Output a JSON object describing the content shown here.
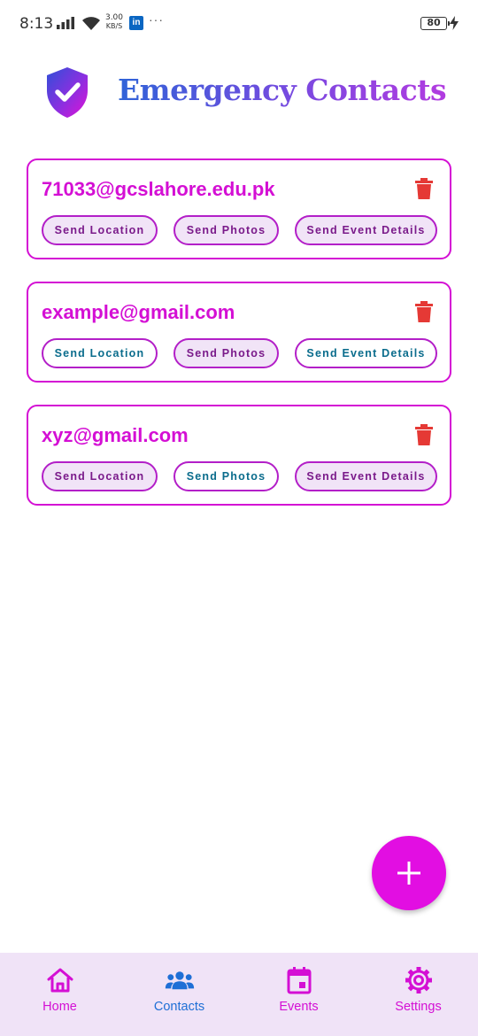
{
  "status_bar": {
    "time": "8:13",
    "network_speed_value": "3.00",
    "network_speed_unit": "KB/S",
    "notification_app": "in",
    "more": "···",
    "battery": "80"
  },
  "header": {
    "title": "Emergency Contacts",
    "logo_icon": "shield-check-icon"
  },
  "contacts": [
    {
      "email": "71033@gcslahore.edu.pk",
      "actions": {
        "location": "Send Location",
        "photos": "Send Photos",
        "event": "Send Event Details"
      },
      "selected": {
        "location": true,
        "photos": true,
        "event": true
      }
    },
    {
      "email": "example@gmail.com",
      "actions": {
        "location": "Send Location",
        "photos": "Send Photos",
        "event": "Send Event Details"
      },
      "selected": {
        "location": false,
        "photos": true,
        "event": false
      }
    },
    {
      "email": "xyz@gmail.com",
      "actions": {
        "location": "Send Location",
        "photos": "Send Photos",
        "event": "Send Event Details"
      },
      "selected": {
        "location": true,
        "photos": false,
        "event": true
      }
    }
  ],
  "fab": {
    "icon": "plus-icon"
  },
  "bottom_nav": {
    "items": [
      {
        "label": "Home",
        "icon": "home-icon",
        "color": "#d40fd4"
      },
      {
        "label": "Contacts",
        "icon": "people-icon",
        "color": "#1e6fd6",
        "active": true
      },
      {
        "label": "Events",
        "icon": "calendar-icon",
        "color": "#d40fd4"
      },
      {
        "label": "Settings",
        "icon": "gear-icon",
        "color": "#d40fd4"
      }
    ]
  },
  "colors": {
    "accent": "#d40fd4",
    "chip_text": "#0a6c8c",
    "chip_selected_bg": "#f1e4f7",
    "delete": "#e53935",
    "nav_bg": "#f0e3f7",
    "active_nav": "#1e6fd6"
  }
}
